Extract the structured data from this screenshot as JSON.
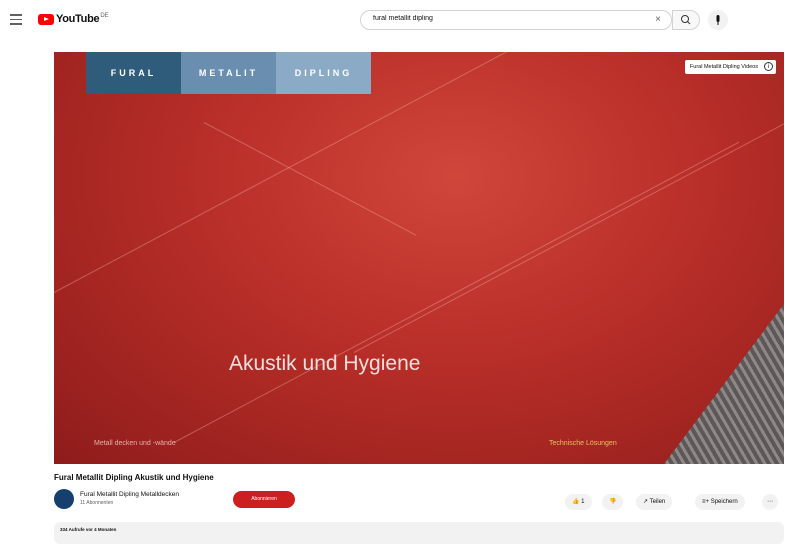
{
  "app": {
    "logo_text": "YouTube",
    "logo_country": "DE"
  },
  "search": {
    "value": "fural metallit dipling"
  },
  "player": {
    "brand_segments": [
      "FURAL",
      "METALIT",
      "DIPLING"
    ],
    "channel_chip": "Fural Metallit Dipling Videos",
    "overlay_title": "Akustik und Hygiene",
    "caption_left": "Metall decken und -wände",
    "caption_right": "Technische Lösungen"
  },
  "video": {
    "title": "Fural Metallit Dipling Akustik und Hygiene",
    "channel_name": "Fural Metallit Dipling Metalldecken",
    "subscribers": "11 Abonnenten",
    "subscribe_label": "Abonnieren",
    "like_count": "1",
    "share_label": "Teilen",
    "save_label": "Speichern"
  },
  "description": {
    "meta": "334 Aufrufe  vor 4 Monaten"
  }
}
